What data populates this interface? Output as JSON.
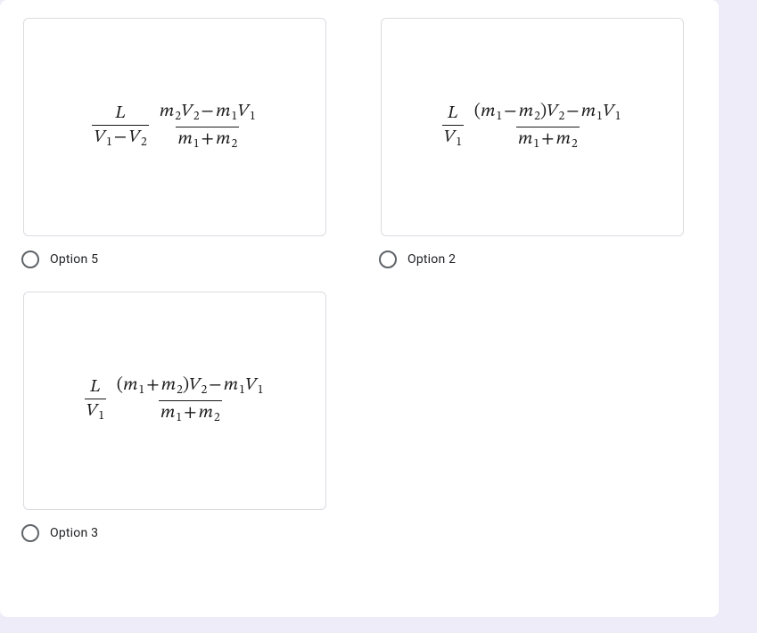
{
  "options": [
    {
      "id": "option5",
      "label": "Option 5",
      "formula": {
        "frac1_num": "L",
        "frac1_den": "V₁ − V₂",
        "frac2_num": "m₂V₂ − m₁V₁",
        "frac2_den": "m₁ + m₂"
      }
    },
    {
      "id": "option2",
      "label": "Option 2",
      "formula": {
        "frac1_num": "L",
        "frac1_den": "V₁",
        "frac2_num": "(m₁ − m₂)V₂ − m₁V₁",
        "frac2_den": "m₁ + m₂"
      }
    },
    {
      "id": "option3",
      "label": "Option 3",
      "formula": {
        "frac1_num": "L",
        "frac1_den": "V₁",
        "frac2_num": "(m₁ + m₂)V₂ − m₁V₁",
        "frac2_den": "m₁ + m₂"
      }
    }
  ]
}
